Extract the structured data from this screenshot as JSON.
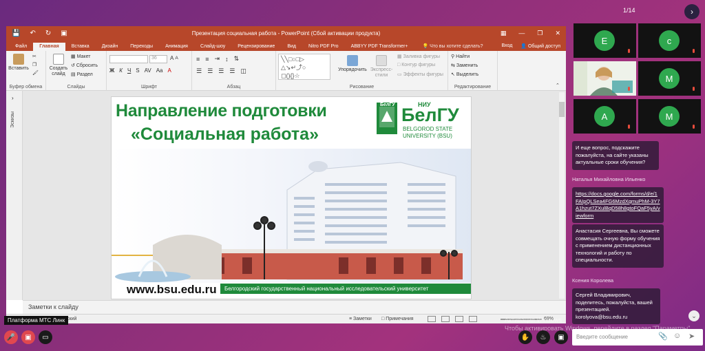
{
  "page_counter": "1/14",
  "next_icon": "chevron-right-icon",
  "powerpoint": {
    "window_title": "Презентация социальная работа - PowerPoint (Сбой активации продукта)",
    "tabs": [
      "Файл",
      "Главная",
      "Вставка",
      "Дизайн",
      "Переходы",
      "Анимация",
      "Слайд-шоу",
      "Рецензирование",
      "Вид",
      "Nitro PDF Pro",
      "ABBYY PDF Transformer+"
    ],
    "active_tab": "Главная",
    "tell_me": "Что вы хотите сделать?",
    "sign_in": "Вход",
    "share": "Общий доступ",
    "ribbon": {
      "paste": "Вставить",
      "create_slide": "Создать слайд",
      "layout": "Макет",
      "reset": "Сбросить",
      "section": "Раздел",
      "font_size": "36",
      "arrange": "Упорядочить",
      "quick_styles": "Экспресс-стили",
      "shape_fill": "Заливка фигуры",
      "shape_outline": "Контур фигуры",
      "shape_effects": "Эффекты фигуры",
      "find": "Найти",
      "replace": "Заменить",
      "select": "Выделить",
      "groups": {
        "clipboard": "Буфер обмена",
        "slides": "Слайды",
        "font": "Шрифт",
        "paragraph": "Абзац",
        "drawing": "Рисование",
        "editing": "Редактирование"
      }
    },
    "thumbnails_label": "Эскизы",
    "slide": {
      "title_line1": "Направление подготовки",
      "title_line2": "«Социальная работа»",
      "logo_niu": "НИУ",
      "logo_belgu": "БелГУ",
      "logo_line1": "BELGOROD STATE",
      "logo_line2": "UNIVERSITY (BSU)",
      "website": "www.bsu.edu.ru",
      "university_banner": "Белгородский государственный национальный исследовательский университет"
    },
    "notes_placeholder": "Заметки к слайду",
    "status": {
      "language": "ский",
      "notes": "Заметки",
      "comments": "Примечания",
      "zoom": "69%"
    }
  },
  "platform_label": "Платформа МТС Линк",
  "activation": {
    "line1": "Активация Windows",
    "line2": "Чтобы активировать Windows, перейдите в раздел \"Параметры\"."
  },
  "participants": [
    {
      "initial": "E",
      "color": "#2fa84f",
      "muted": true
    },
    {
      "initial": "c",
      "color": "#2fa84f",
      "muted": true
    },
    {
      "initial": "",
      "color": "",
      "muted": true,
      "video": true
    },
    {
      "initial": "M",
      "color": "#2fa84f",
      "muted": true
    },
    {
      "initial": "A",
      "color": "#2fa84f",
      "muted": true
    },
    {
      "initial": "M",
      "color": "#2fa84f",
      "muted": true
    }
  ],
  "chat": {
    "msg1": "И еще вопрос, подскажите пожалуйста, на сайте указаны актуальные сроки обучения?",
    "author1": "Наталья Михайловна Ильенко",
    "link": "https://docs.google.com/forms/d/e/1FAIpQLSea4FG6MzdXqmuPhM-3Y7A1hzut7ZXulBqD58h8gtoFQaF5yA/viewform",
    "msg2": "Анастасия Сергеевна, Вы сможете совмещать очную форму обучения с применением дистанционных технологий и работу по специальности.",
    "author2": "Ксения Королева",
    "msg3": "Сергей Владимирович, поделитесь, пожалуйста, вашей презентацией. korolyova@bsu.edu.ru",
    "input_placeholder": "Введите сообщение"
  },
  "colors": {
    "ppt_accent": "#b7472a",
    "brand_green": "#1f8a3b",
    "mute_red": "#e74c3c"
  }
}
